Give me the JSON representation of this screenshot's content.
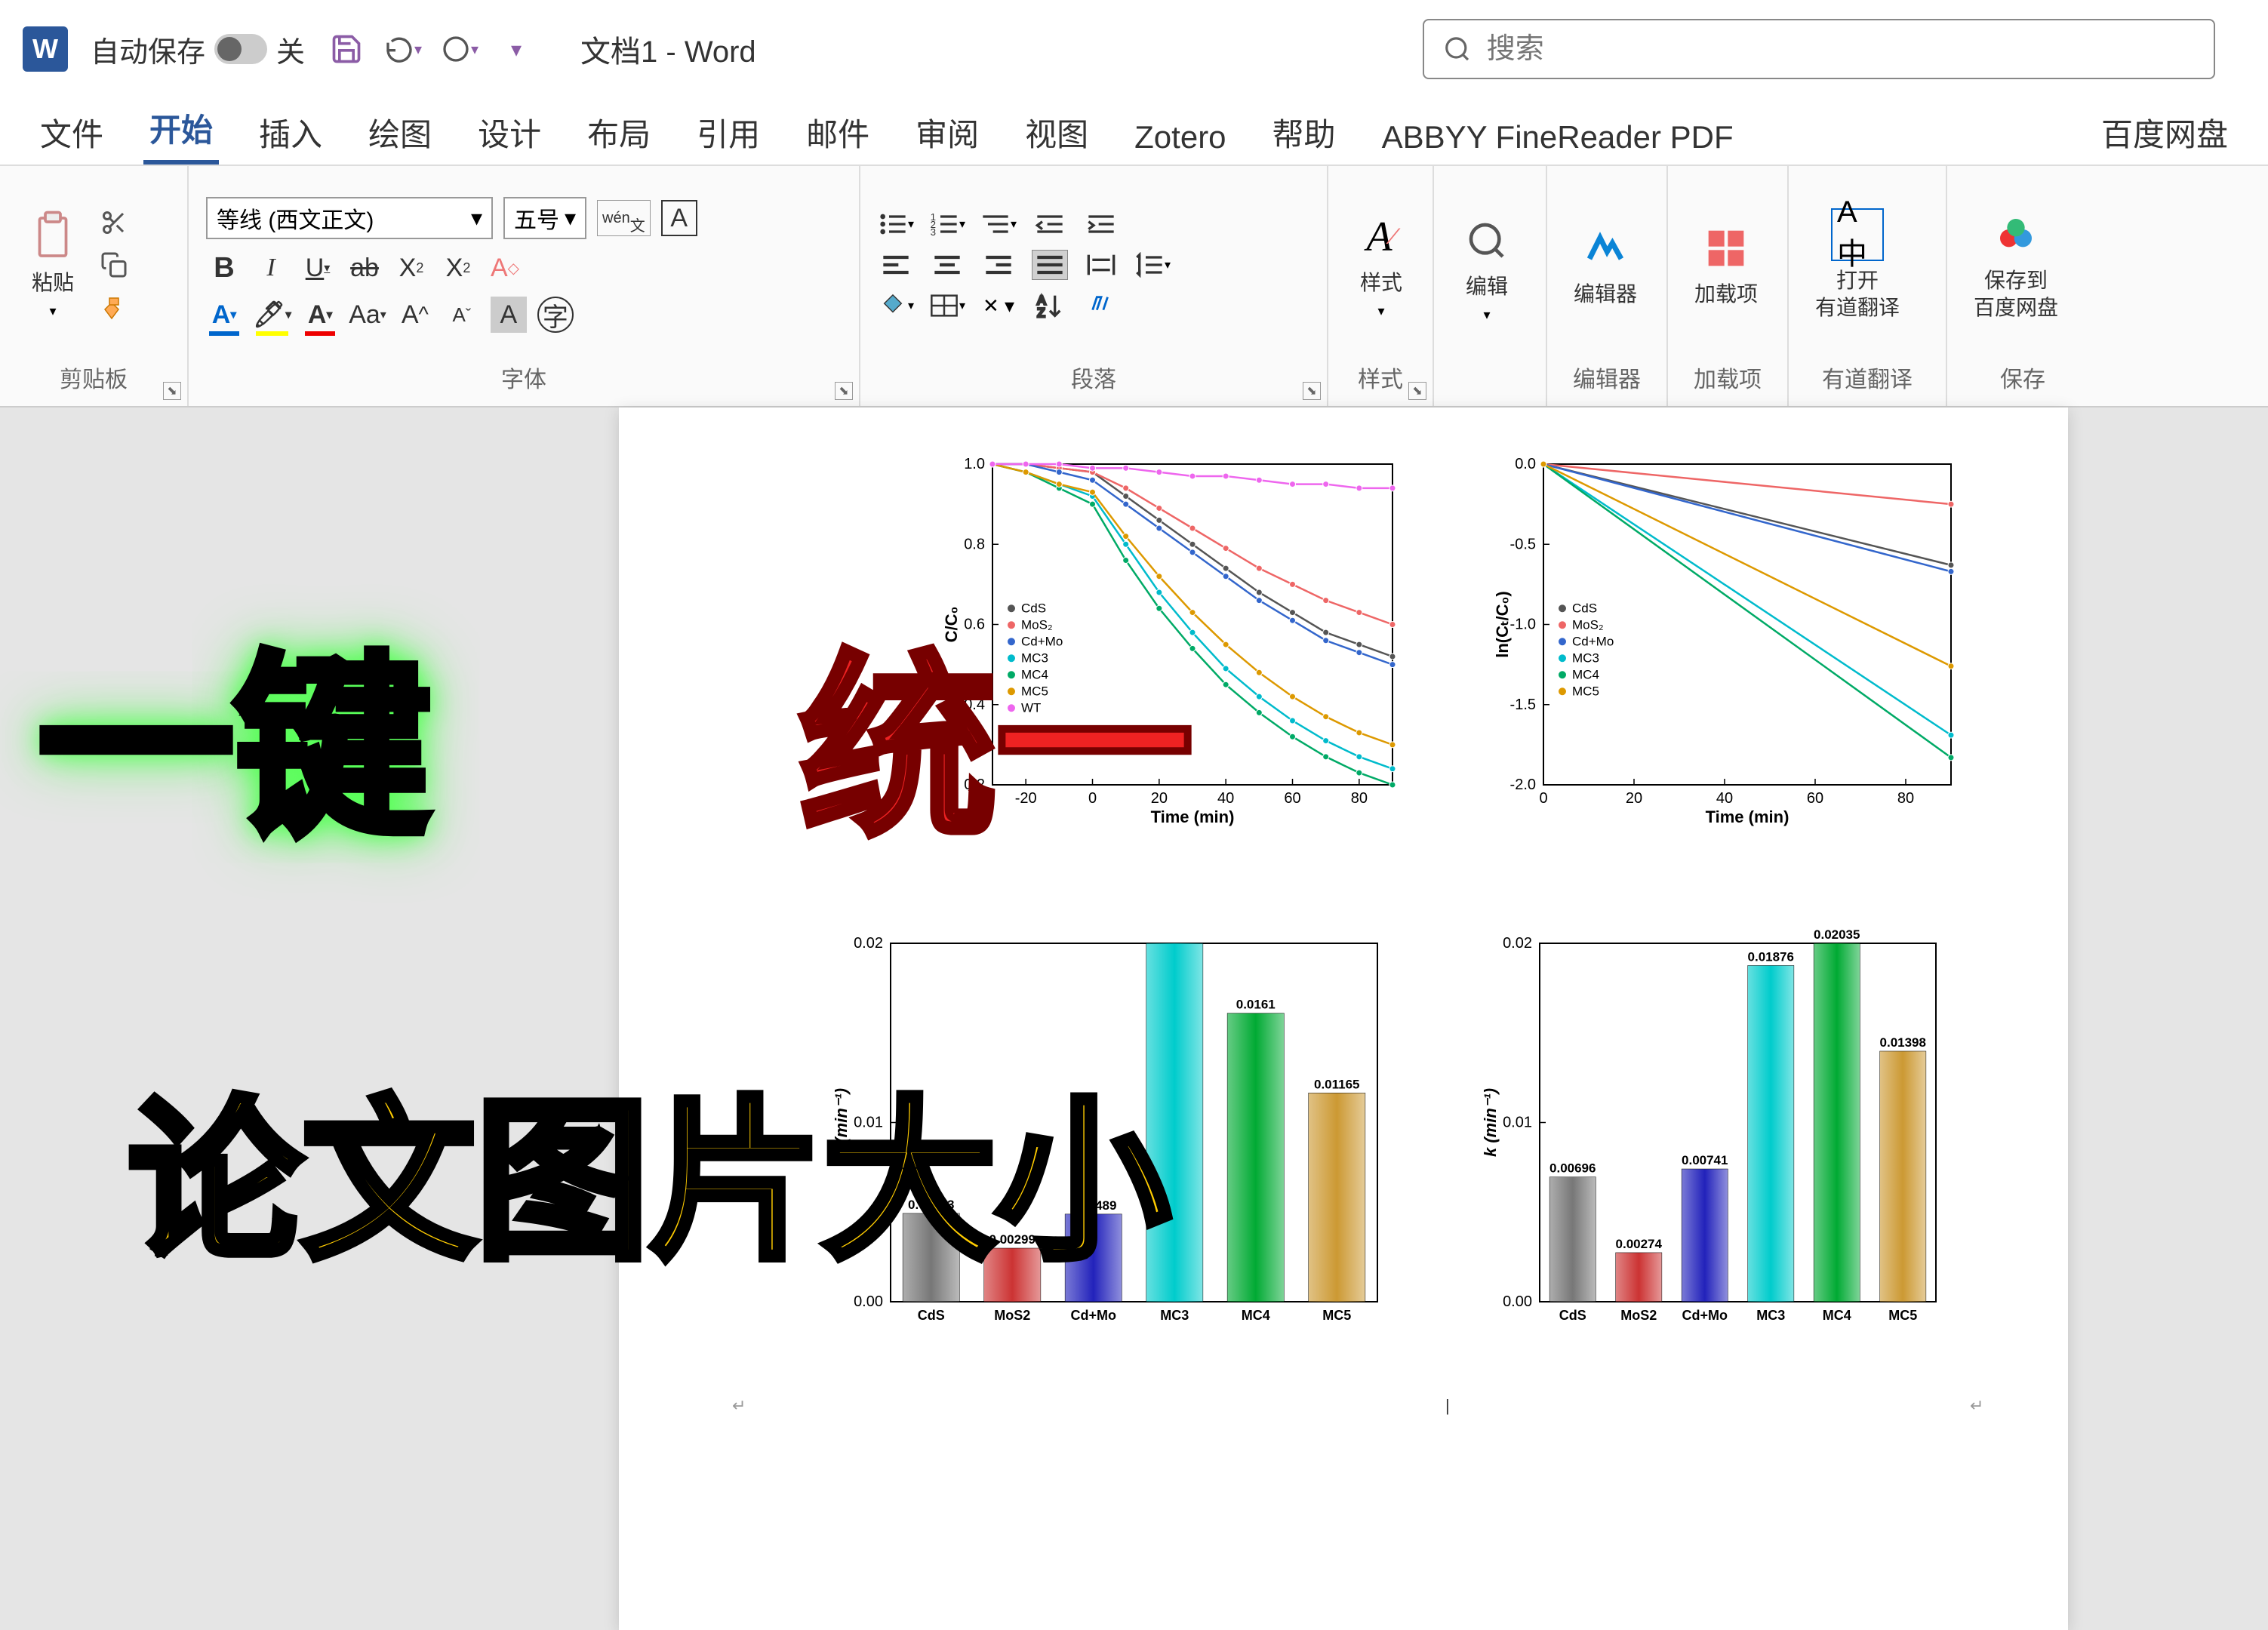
{
  "titlebar": {
    "autosave_label": "自动保存",
    "autosave_state": "关",
    "doc_title": "文档1  -  Word",
    "search_placeholder": "搜索"
  },
  "tabs": [
    "文件",
    "开始",
    "插入",
    "绘图",
    "设计",
    "布局",
    "引用",
    "邮件",
    "审阅",
    "视图",
    "Zotero",
    "帮助",
    "ABBYY FineReader PDF",
    "百度网盘"
  ],
  "active_tab": "开始",
  "ribbon": {
    "clipboard": {
      "label": "剪贴板",
      "paste": "粘贴"
    },
    "font": {
      "label": "字体",
      "name": "等线 (西文正文)",
      "size": "五号",
      "wen": "wén"
    },
    "paragraph": {
      "label": "段落"
    },
    "styles": {
      "label": "样式",
      "btn": "样式"
    },
    "editing": {
      "label": "",
      "btn": "编辑"
    },
    "editor": {
      "label": "编辑器",
      "btn": "编辑器"
    },
    "addins": {
      "label": "加载项",
      "btn": "加载项"
    },
    "youdao": {
      "label": "有道翻译",
      "btn": "打开\n有道翻译"
    },
    "baidu": {
      "label": "保存",
      "btn": "保存到\n百度网盘"
    }
  },
  "overlay": {
    "line1a": "一键",
    "line1b": "统一",
    "line2": "论文图片大小"
  },
  "chart_data": [
    {
      "type": "line",
      "title": "",
      "xlabel": "Time (min)",
      "ylabel": "C/C₀",
      "xlim": [
        -30,
        90
      ],
      "ylim": [
        0.2,
        1.0
      ],
      "xticks": [
        -20,
        0,
        20,
        40,
        60,
        80
      ],
      "yticks": [
        0.2,
        0.4,
        0.6,
        0.8,
        1.0
      ],
      "series": [
        {
          "name": "CdS",
          "color": "#555",
          "values": [
            [
              -30,
              1.0
            ],
            [
              -20,
              1.0
            ],
            [
              -10,
              0.99
            ],
            [
              0,
              0.98
            ],
            [
              10,
              0.92
            ],
            [
              20,
              0.86
            ],
            [
              30,
              0.8
            ],
            [
              40,
              0.74
            ],
            [
              50,
              0.68
            ],
            [
              60,
              0.63
            ],
            [
              70,
              0.58
            ],
            [
              80,
              0.55
            ],
            [
              90,
              0.52
            ]
          ]
        },
        {
          "name": "MoS₂",
          "color": "#e66",
          "values": [
            [
              -30,
              1.0
            ],
            [
              -20,
              1.0
            ],
            [
              -10,
              0.99
            ],
            [
              0,
              0.98
            ],
            [
              10,
              0.94
            ],
            [
              20,
              0.89
            ],
            [
              30,
              0.84
            ],
            [
              40,
              0.79
            ],
            [
              50,
              0.74
            ],
            [
              60,
              0.7
            ],
            [
              70,
              0.66
            ],
            [
              80,
              0.63
            ],
            [
              90,
              0.6
            ]
          ]
        },
        {
          "name": "Cd+Mo",
          "color": "#36c",
          "values": [
            [
              -30,
              1.0
            ],
            [
              -20,
              1.0
            ],
            [
              -10,
              0.98
            ],
            [
              0,
              0.96
            ],
            [
              10,
              0.9
            ],
            [
              20,
              0.84
            ],
            [
              30,
              0.78
            ],
            [
              40,
              0.72
            ],
            [
              50,
              0.66
            ],
            [
              60,
              0.61
            ],
            [
              70,
              0.56
            ],
            [
              80,
              0.53
            ],
            [
              90,
              0.5
            ]
          ]
        },
        {
          "name": "MC3",
          "color": "#0bc",
          "values": [
            [
              -30,
              1.0
            ],
            [
              -20,
              0.98
            ],
            [
              -10,
              0.95
            ],
            [
              0,
              0.92
            ],
            [
              10,
              0.8
            ],
            [
              20,
              0.68
            ],
            [
              30,
              0.58
            ],
            [
              40,
              0.49
            ],
            [
              50,
              0.42
            ],
            [
              60,
              0.36
            ],
            [
              70,
              0.31
            ],
            [
              80,
              0.27
            ],
            [
              90,
              0.24
            ]
          ]
        },
        {
          "name": "MC4",
          "color": "#0a6",
          "values": [
            [
              -30,
              1.0
            ],
            [
              -20,
              0.98
            ],
            [
              -10,
              0.94
            ],
            [
              0,
              0.9
            ],
            [
              10,
              0.76
            ],
            [
              20,
              0.64
            ],
            [
              30,
              0.54
            ],
            [
              40,
              0.45
            ],
            [
              50,
              0.38
            ],
            [
              60,
              0.32
            ],
            [
              70,
              0.27
            ],
            [
              80,
              0.23
            ],
            [
              90,
              0.2
            ]
          ]
        },
        {
          "name": "MC5",
          "color": "#d90",
          "values": [
            [
              -30,
              1.0
            ],
            [
              -20,
              0.98
            ],
            [
              -10,
              0.95
            ],
            [
              0,
              0.93
            ],
            [
              10,
              0.82
            ],
            [
              20,
              0.72
            ],
            [
              30,
              0.63
            ],
            [
              40,
              0.55
            ],
            [
              50,
              0.48
            ],
            [
              60,
              0.42
            ],
            [
              70,
              0.37
            ],
            [
              80,
              0.33
            ],
            [
              90,
              0.3
            ]
          ]
        },
        {
          "name": "WT",
          "color": "#e6e",
          "values": [
            [
              -30,
              1.0
            ],
            [
              -20,
              1.0
            ],
            [
              -10,
              1.0
            ],
            [
              0,
              0.99
            ],
            [
              10,
              0.99
            ],
            [
              20,
              0.98
            ],
            [
              30,
              0.97
            ],
            [
              40,
              0.97
            ],
            [
              50,
              0.96
            ],
            [
              60,
              0.95
            ],
            [
              70,
              0.95
            ],
            [
              80,
              0.94
            ],
            [
              90,
              0.94
            ]
          ]
        }
      ]
    },
    {
      "type": "line",
      "title": "",
      "xlabel": "Time (min)",
      "ylabel": "ln(Cₜ/C₀)",
      "xlim": [
        0,
        90
      ],
      "ylim": [
        -2.0,
        0.0
      ],
      "xticks": [
        0,
        20,
        40,
        60,
        80
      ],
      "yticks": [
        -2.0,
        -1.5,
        -1.0,
        -0.5,
        0.0
      ],
      "series": [
        {
          "name": "CdS",
          "color": "#555",
          "values": [
            [
              0,
              0
            ],
            [
              90,
              -0.63
            ]
          ]
        },
        {
          "name": "MoS₂",
          "color": "#e66",
          "values": [
            [
              0,
              0
            ],
            [
              90,
              -0.25
            ]
          ]
        },
        {
          "name": "Cd+Mo",
          "color": "#36c",
          "values": [
            [
              0,
              0
            ],
            [
              90,
              -0.67
            ]
          ]
        },
        {
          "name": "MC3",
          "color": "#0bc",
          "values": [
            [
              0,
              0
            ],
            [
              90,
              -1.69
            ]
          ]
        },
        {
          "name": "MC4",
          "color": "#0a6",
          "values": [
            [
              0,
              0
            ],
            [
              90,
              -1.83
            ]
          ]
        },
        {
          "name": "MC5",
          "color": "#d90",
          "values": [
            [
              0,
              0
            ],
            [
              90,
              -1.26
            ]
          ]
        }
      ]
    },
    {
      "type": "bar",
      "title": "",
      "xlabel": "",
      "ylabel": "k (min⁻¹)",
      "ylim": [
        0.0,
        0.02
      ],
      "yticks": [
        0.0,
        0.01,
        0.02
      ],
      "categories": [
        "CdS",
        "MoS2",
        "Cd+Mo",
        "MC3",
        "MC4",
        "MC5"
      ],
      "values": [
        0.00493,
        0.00299,
        0.00489,
        0.02,
        0.0161,
        0.01165
      ],
      "value_labels": [
        "0.00493",
        "0.00299",
        "0.00489",
        "",
        "0.0161",
        "0.01165"
      ],
      "colors": [
        "#777",
        "#c33",
        "#22b",
        "#0cc",
        "#0a3",
        "#c93"
      ]
    },
    {
      "type": "bar",
      "title": "",
      "xlabel": "",
      "ylabel": "k (min⁻¹)",
      "ylim": [
        0.0,
        0.02
      ],
      "yticks": [
        0.0,
        0.01,
        0.02
      ],
      "categories": [
        "CdS",
        "MoS2",
        "Cd+Mo",
        "MC3",
        "MC4",
        "MC5"
      ],
      "values": [
        0.00696,
        0.00274,
        0.00741,
        0.01876,
        0.02035,
        0.01398
      ],
      "value_labels": [
        "0.00696",
        "0.00274",
        "0.00741",
        "0.01876",
        "0.02035",
        "0.01398"
      ],
      "colors": [
        "#777",
        "#c33",
        "#22b",
        "#0cc",
        "#0a3",
        "#c93"
      ]
    }
  ]
}
